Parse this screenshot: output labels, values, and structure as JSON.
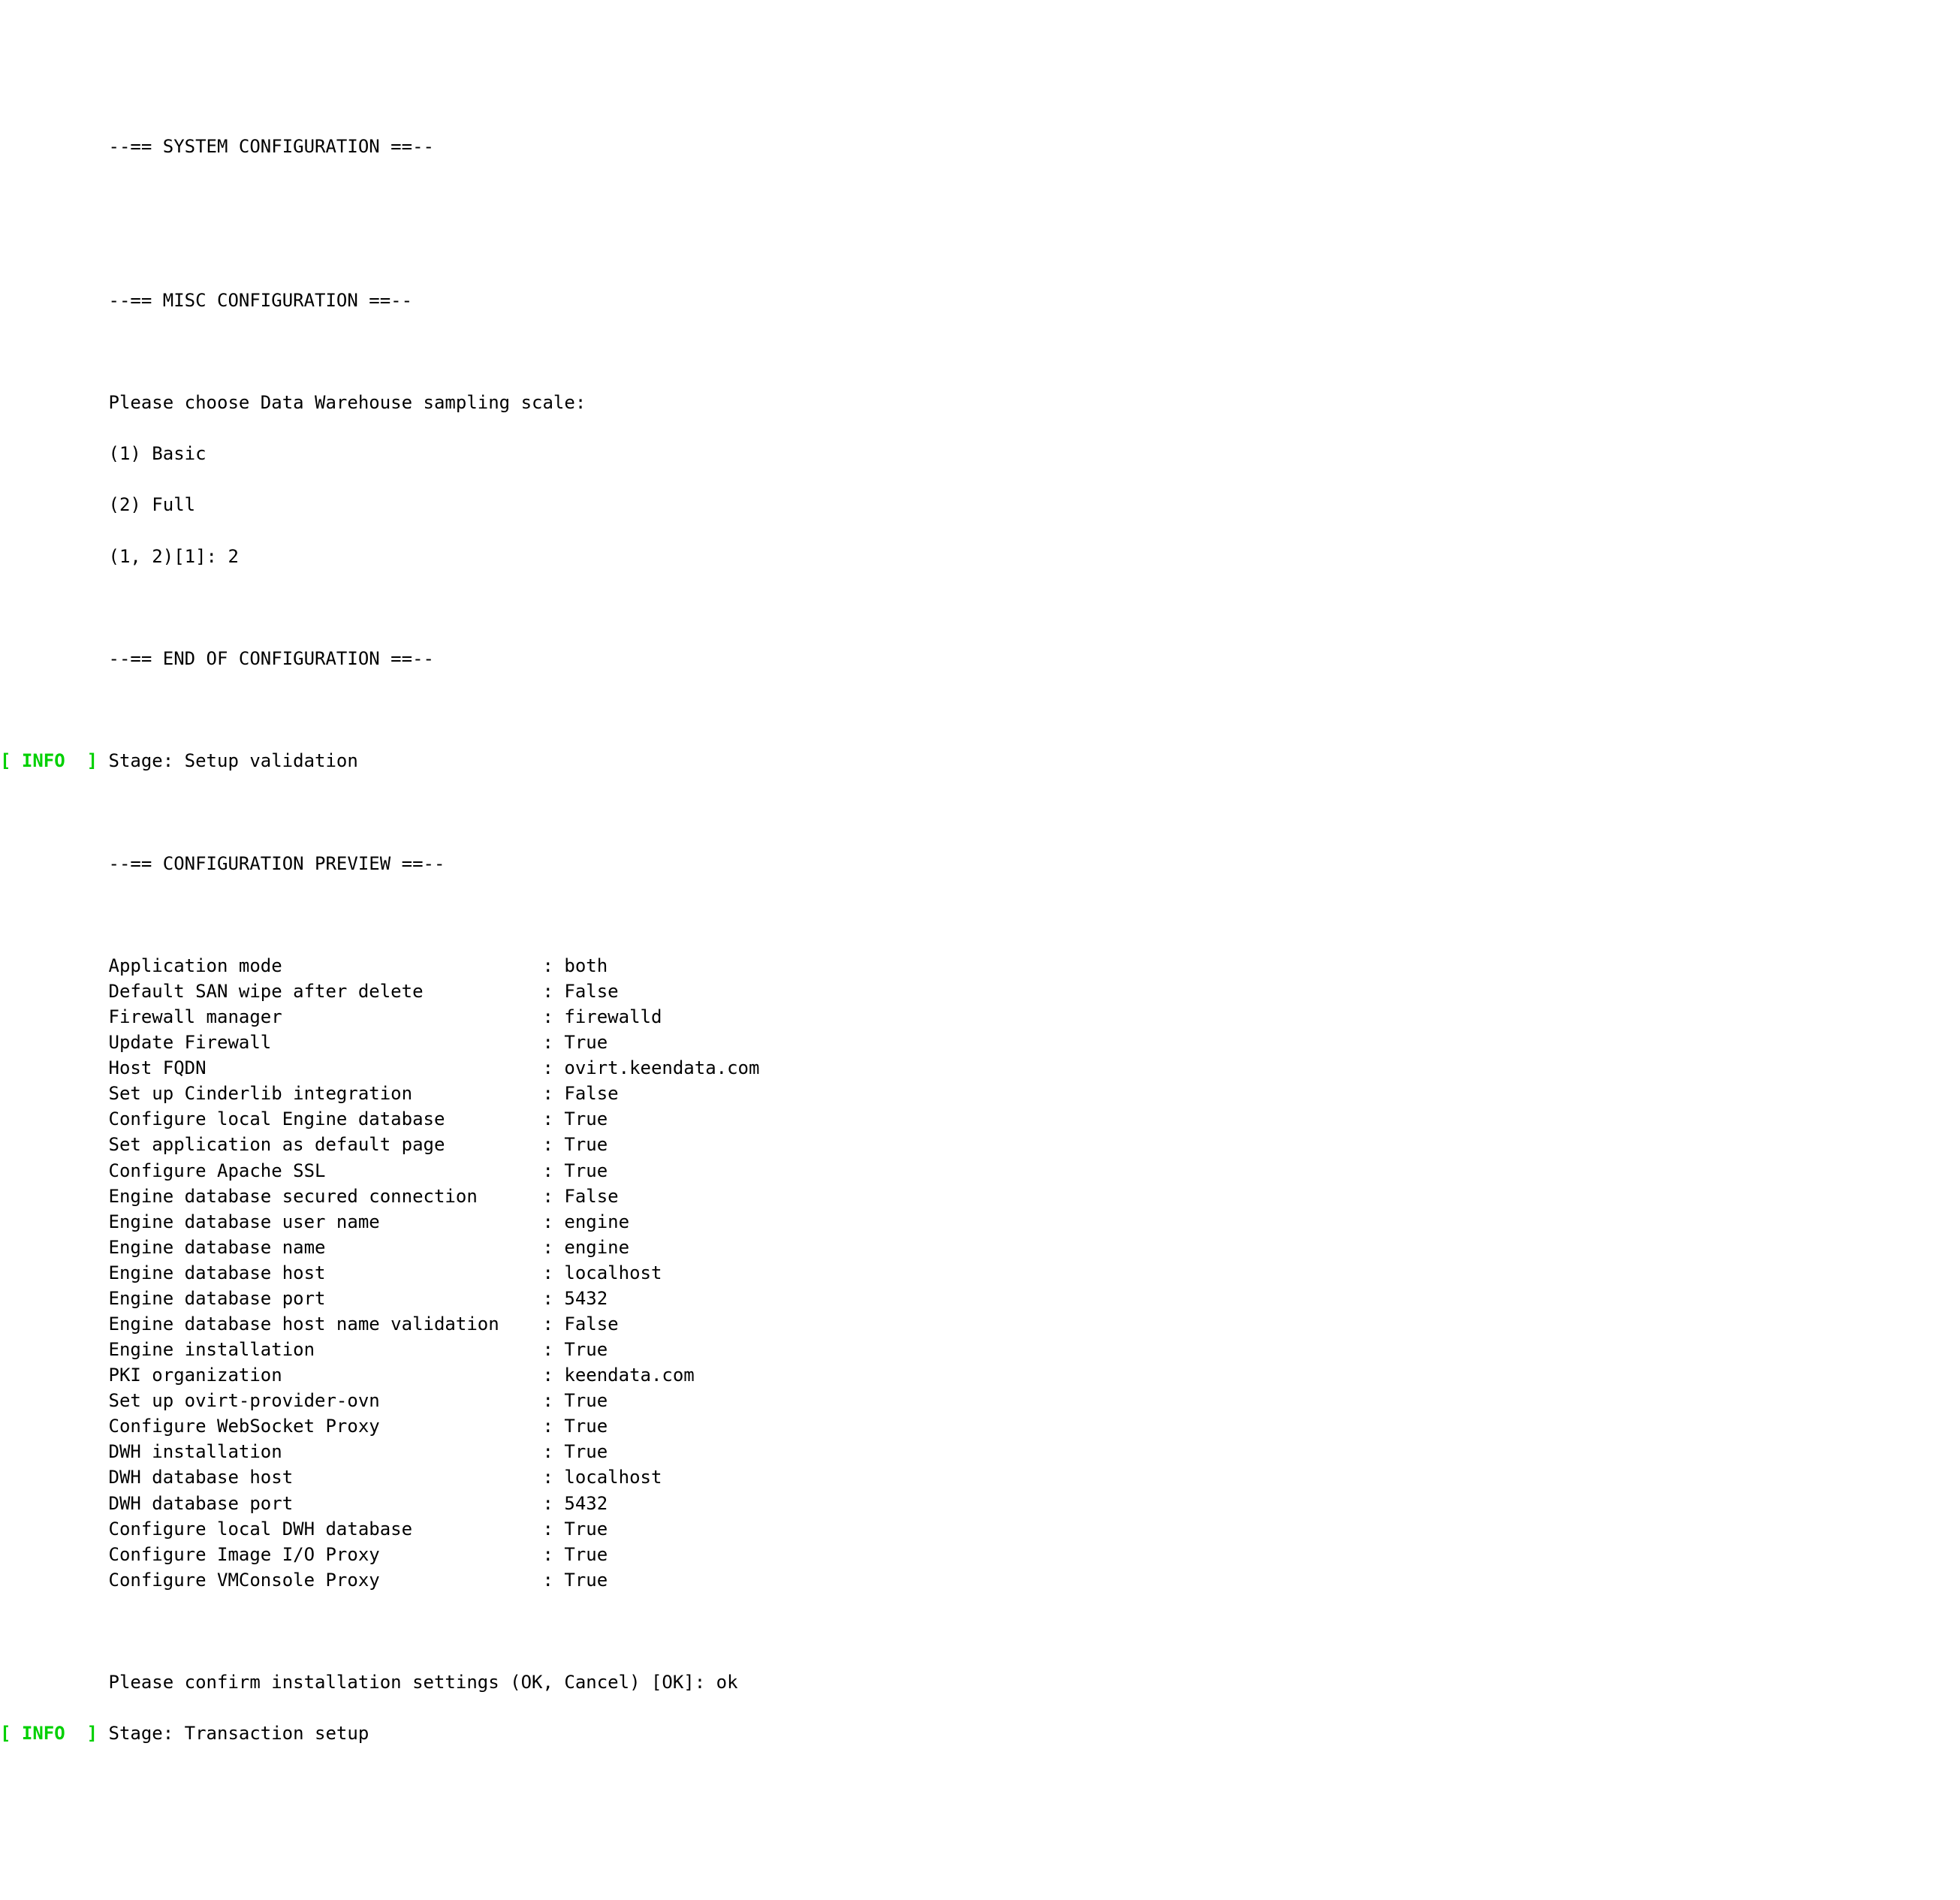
{
  "indent": "          ",
  "sections": {
    "system_config_header": "--== SYSTEM CONFIGURATION ==--",
    "misc_config_header": "--== MISC CONFIGURATION ==--",
    "end_config_header": "--== END OF CONFIGURATION ==--",
    "config_preview_header": "--== CONFIGURATION PREVIEW ==--"
  },
  "prompts": {
    "dwh_scale_prompt": "Please choose Data Warehouse sampling scale:",
    "option1": "(1) Basic",
    "option2": "(2) Full",
    "choice_line": "(1, 2)[1]: 2",
    "confirm_prompt": "Please confirm installation settings (OK, Cancel) [OK]: ok"
  },
  "info_tag": "[ INFO  ]",
  "info_messages": {
    "setup_validation": " Stage: Setup validation",
    "transaction_setup": " Stage: Transaction setup"
  },
  "config_items": [
    {
      "label": "Application mode                        ",
      "value": ": both"
    },
    {
      "label": "Default SAN wipe after delete           ",
      "value": ": False"
    },
    {
      "label": "Firewall manager                        ",
      "value": ": firewalld"
    },
    {
      "label": "Update Firewall                         ",
      "value": ": True"
    },
    {
      "label": "Host FQDN                               ",
      "value": ": ovirt.keendata.com"
    },
    {
      "label": "Set up Cinderlib integration            ",
      "value": ": False"
    },
    {
      "label": "Configure local Engine database         ",
      "value": ": True"
    },
    {
      "label": "Set application as default page         ",
      "value": ": True"
    },
    {
      "label": "Configure Apache SSL                    ",
      "value": ": True"
    },
    {
      "label": "Engine database secured connection      ",
      "value": ": False"
    },
    {
      "label": "Engine database user name               ",
      "value": ": engine"
    },
    {
      "label": "Engine database name                    ",
      "value": ": engine"
    },
    {
      "label": "Engine database host                    ",
      "value": ": localhost"
    },
    {
      "label": "Engine database port                    ",
      "value": ": 5432"
    },
    {
      "label": "Engine database host name validation    ",
      "value": ": False"
    },
    {
      "label": "Engine installation                     ",
      "value": ": True"
    },
    {
      "label": "PKI organization                        ",
      "value": ": keendata.com"
    },
    {
      "label": "Set up ovirt-provider-ovn               ",
      "value": ": True"
    },
    {
      "label": "Configure WebSocket Proxy               ",
      "value": ": True"
    },
    {
      "label": "DWH installation                        ",
      "value": ": True"
    },
    {
      "label": "DWH database host                       ",
      "value": ": localhost"
    },
    {
      "label": "DWH database port                       ",
      "value": ": 5432"
    },
    {
      "label": "Configure local DWH database            ",
      "value": ": True"
    },
    {
      "label": "Configure Image I/O Proxy               ",
      "value": ": True"
    },
    {
      "label": "Configure VMConsole Proxy               ",
      "value": ": True"
    }
  ]
}
